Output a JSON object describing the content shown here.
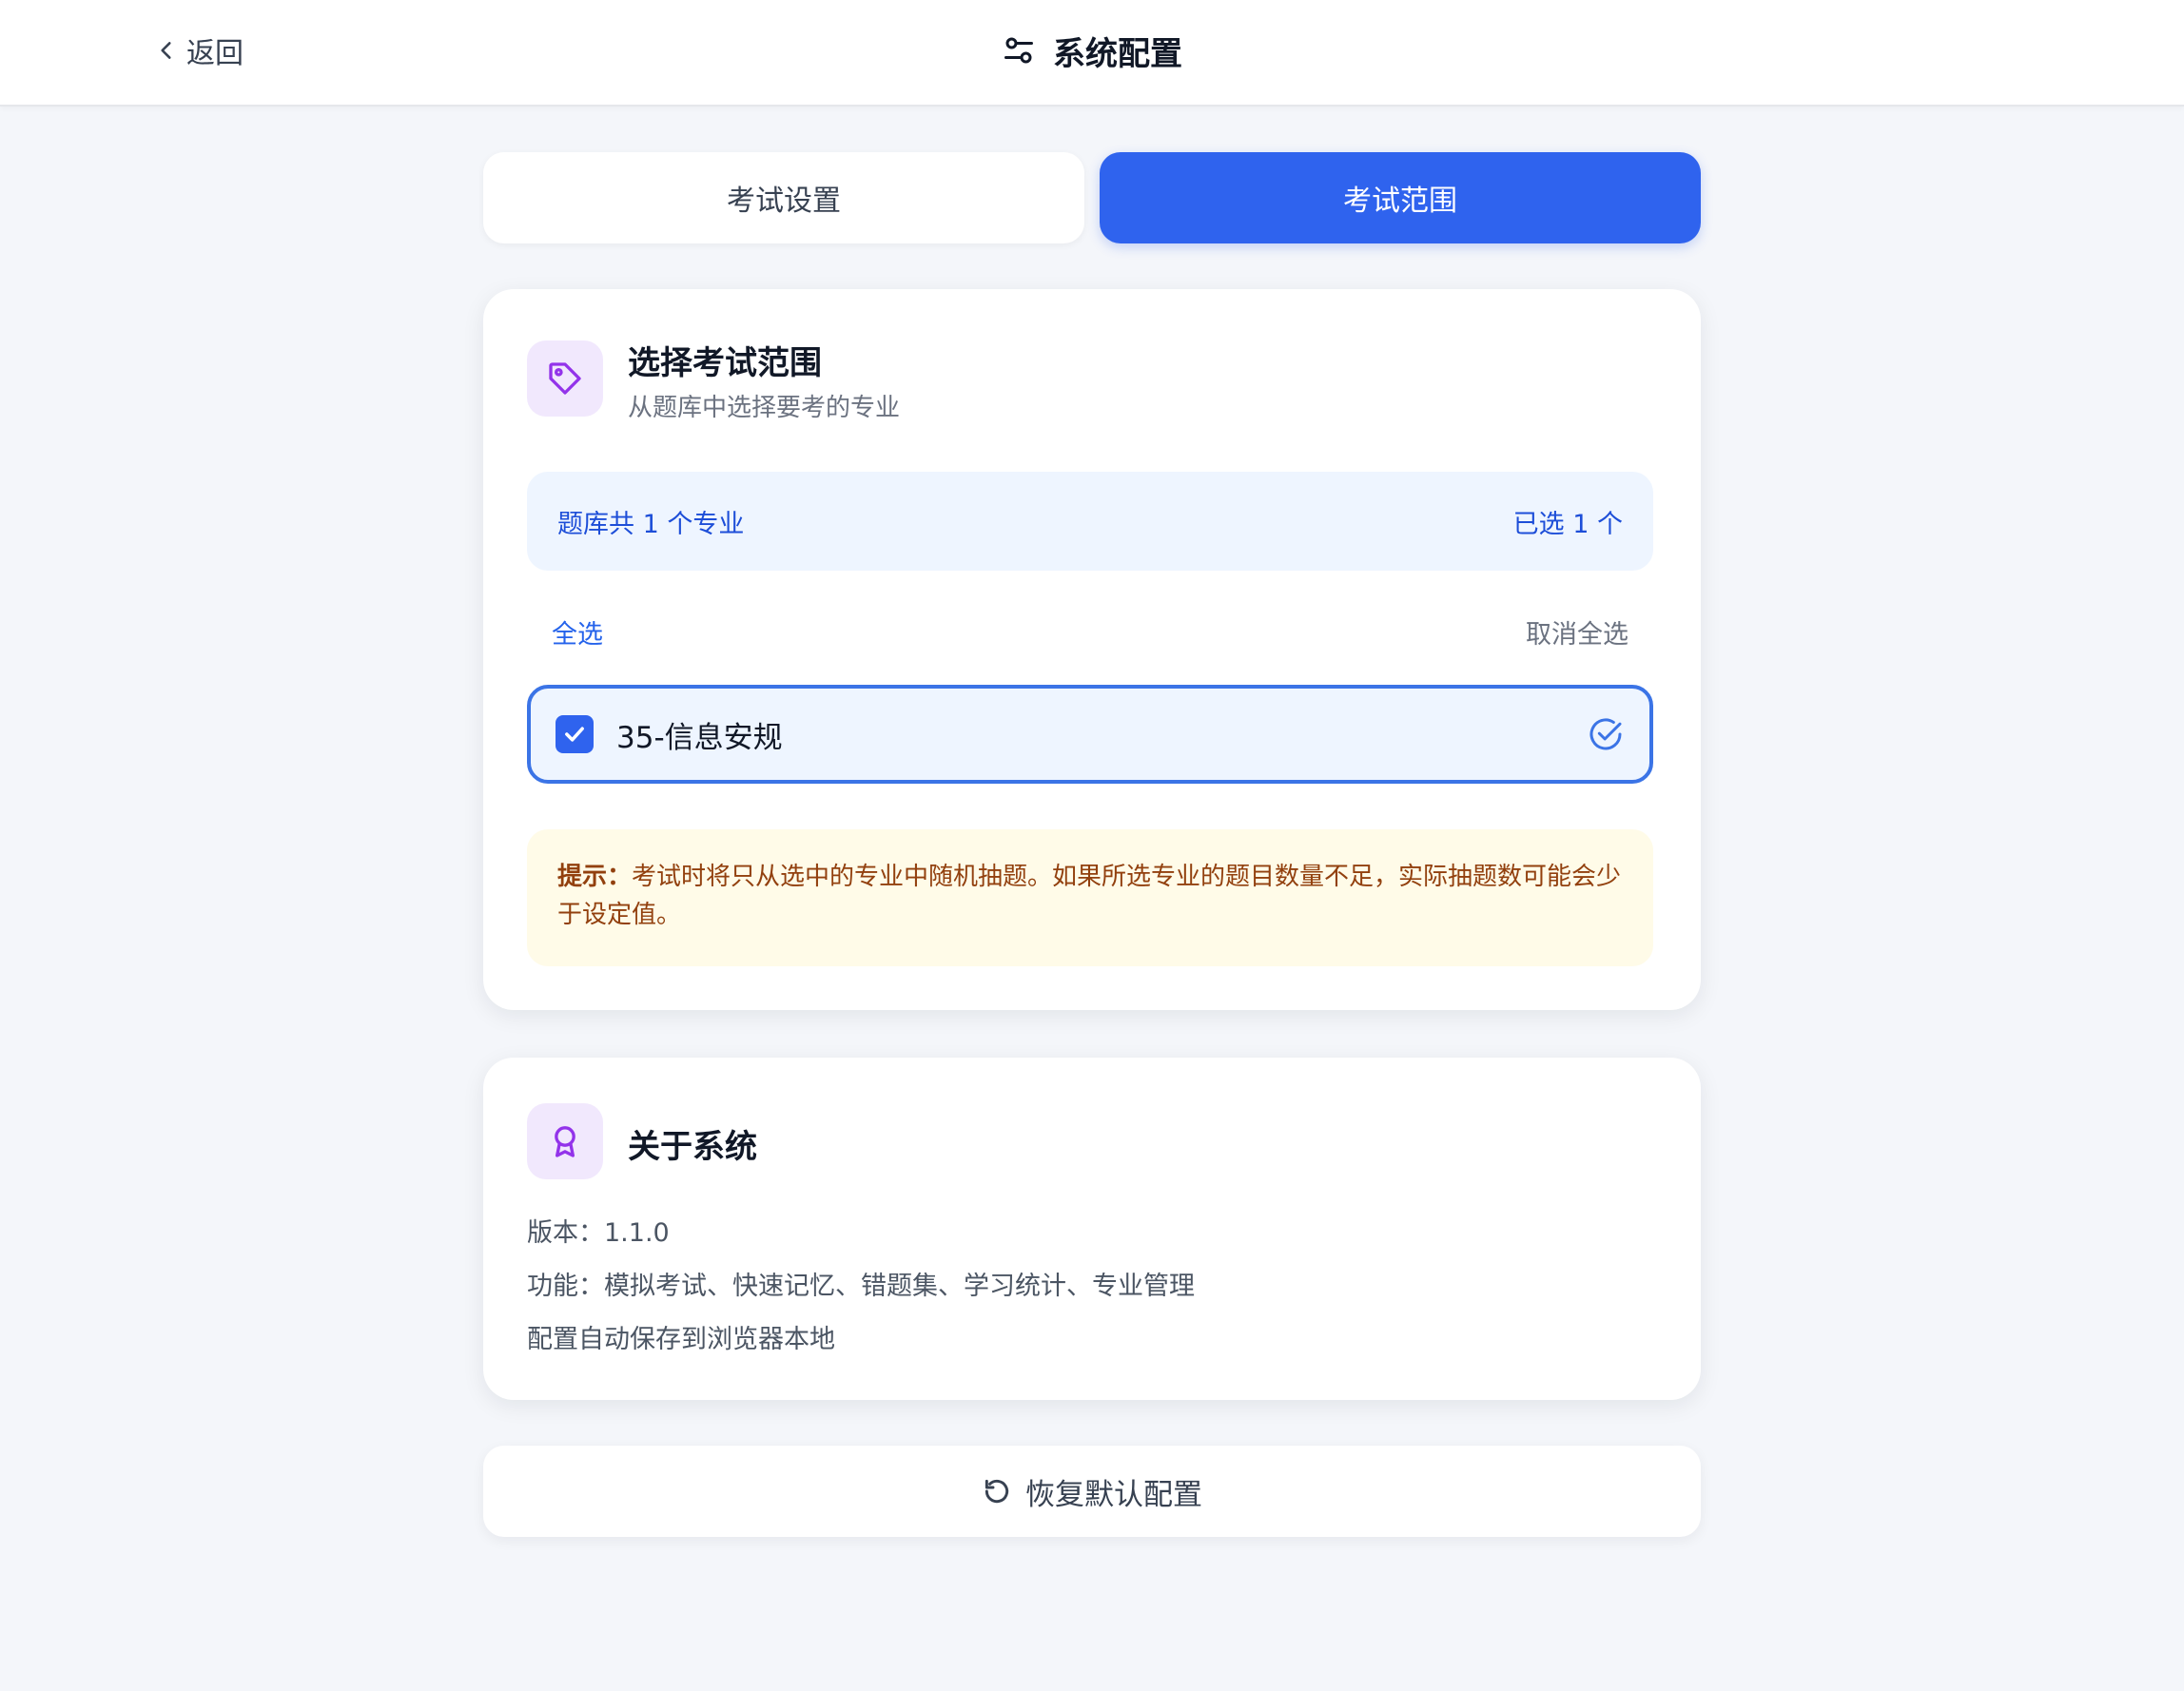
{
  "header": {
    "back_label": "返回",
    "title": "系统配置"
  },
  "tabs": [
    {
      "label": "考试设置",
      "active": false
    },
    {
      "label": "考试范围",
      "active": true
    }
  ],
  "scope_card": {
    "title": "选择考试范围",
    "subtitle": "从题库中选择要考的专业",
    "summary_left": "题库共 1 个专业",
    "summary_right": "已选 1 个",
    "select_all": "全选",
    "deselect_all": "取消全选",
    "options": [
      {
        "label": "35-信息安规",
        "checked": true
      }
    ],
    "tip_prefix": "提示：",
    "tip_text": "考试时将只从选中的专业中随机抽题。如果所选专业的题目数量不足，实际抽题数可能会少于设定值。"
  },
  "about_card": {
    "title": "关于系统",
    "version": "版本：1.1.0",
    "features": "功能：模拟考试、快速记忆、错题集、学习统计、专业管理",
    "note": "配置自动保存到浏览器本地"
  },
  "reset_label": "恢复默认配置",
  "colors": {
    "accent": "#2f63ee",
    "icon_purple": "#9333ea",
    "tip_text": "#92400e"
  }
}
